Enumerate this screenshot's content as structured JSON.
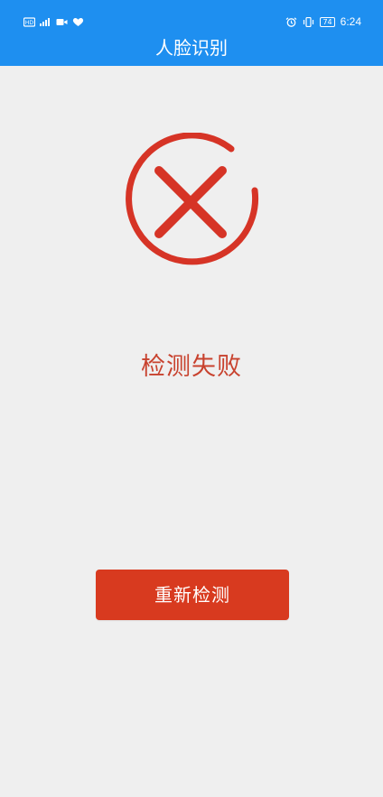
{
  "status_bar": {
    "time": "6:24",
    "battery": "74",
    "left_icons": [
      "sim-icon",
      "signal-icon",
      "video-icon",
      "heart-icon"
    ],
    "right_icons": [
      "alarm-icon",
      "vibrate-icon",
      "battery-icon"
    ]
  },
  "header": {
    "title": "人脸识别",
    "background_color": "#1e8ff0"
  },
  "result": {
    "icon": "failure-x-icon",
    "message": "检测失败",
    "color": "#c8422e"
  },
  "actions": {
    "retry_label": "重新检测",
    "button_color": "#d83a1f"
  }
}
